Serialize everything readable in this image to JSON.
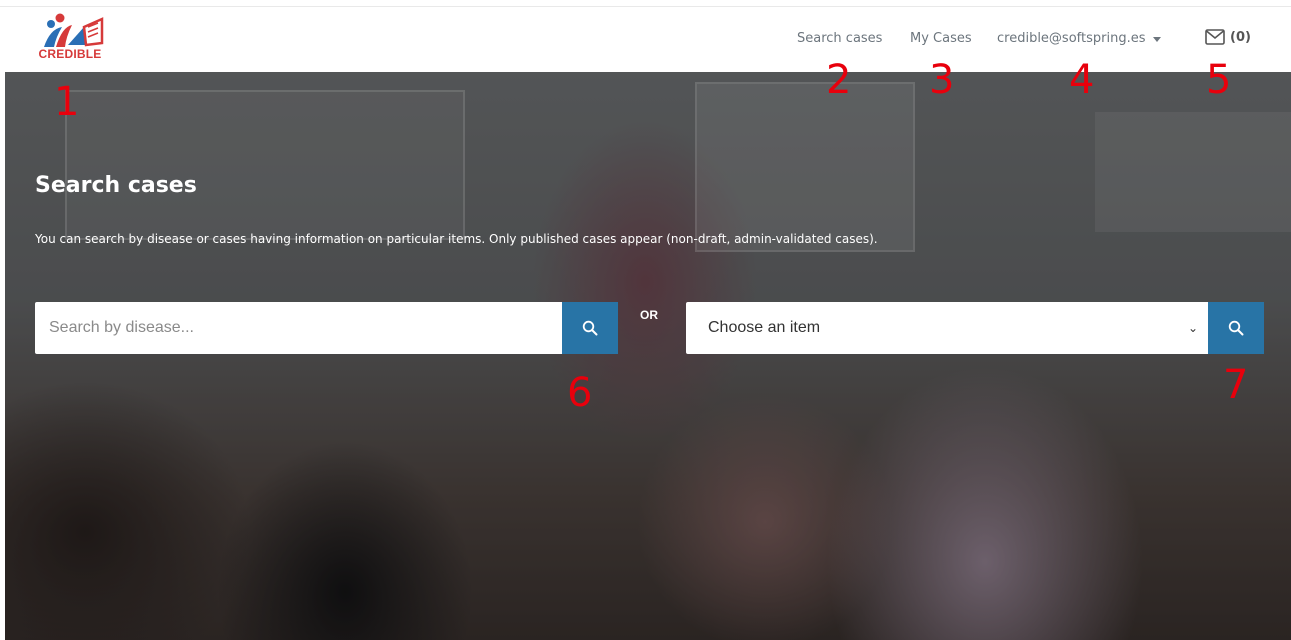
{
  "brand": {
    "name": "CREDIBLE"
  },
  "nav": {
    "search_cases": "Search cases",
    "my_cases": "My Cases",
    "user_email": "credible@softspring.es",
    "messages_count": "(0)"
  },
  "hero": {
    "title": "Search cases",
    "description": "You can search by disease or cases having information on particular items. Only published cases appear (non-draft, admin-validated cases).",
    "disease_placeholder": "Search by disease...",
    "or_label": "OR",
    "item_select_value": "Choose an item"
  },
  "annotations": [
    "1",
    "2",
    "3",
    "4",
    "5",
    "6",
    "7"
  ],
  "icons": {
    "search": "search-icon",
    "mail": "envelope-icon",
    "dropdown": "caret-down-icon",
    "select": "chevron-down-icon"
  },
  "colors": {
    "button": "#2874a6",
    "nav_text": "#6c757d",
    "annotation": "#e8000c",
    "logo_red": "#d63a3a",
    "logo_blue": "#2a6fb5"
  }
}
